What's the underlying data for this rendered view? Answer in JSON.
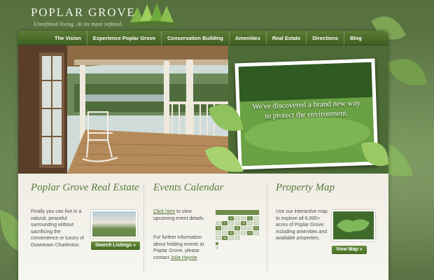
{
  "brand": {
    "name": "POPLAR GROVE",
    "tagline": "Unrefined living. At its most refined."
  },
  "nav": {
    "items": [
      {
        "label": "The Vision"
      },
      {
        "label": "Experience Poplar Grove"
      },
      {
        "label": "Conservation Building"
      },
      {
        "label": "Amenities"
      },
      {
        "label": "Real Estate"
      },
      {
        "label": "Directions"
      },
      {
        "label": "Blog"
      }
    ]
  },
  "hero": {
    "caption_line1": "We've discovered a brand new way",
    "caption_line2": "to protect the environment."
  },
  "real_estate": {
    "title": "Poplar Grove Real Estate",
    "text": "Finally you can live in a natural, peaceful surrounding without sacrificing the convenience or luxury of Downtown Charleston.",
    "button": "Search Listings »"
  },
  "events": {
    "title": "Events Calendar",
    "link": "Click here",
    "text1_rest": " to view upcoming event details.",
    "text2": "For further information about holding events at Poplar Grove, please contact ",
    "contact": "Julia Haynie",
    "text2_end": ".",
    "calendar_days": [
      "1",
      "2",
      "3",
      "4",
      "5",
      "6",
      "7",
      "8",
      "9",
      "10",
      "11",
      "12",
      "13",
      "14",
      "15",
      "16",
      "17",
      "18",
      "19",
      "20",
      "21",
      "22",
      "23",
      "24",
      "25",
      "26",
      "27",
      "28",
      "29",
      "30"
    ],
    "colors": {
      "event": "#6f8e4c",
      "empty": "#ccd6bf"
    }
  },
  "property_map": {
    "title": "Property Map",
    "text": "Use our interactive map to explore all 6,000+ acres of Poplar Grove, including amenities and available properties.",
    "button": "View Map »"
  }
}
